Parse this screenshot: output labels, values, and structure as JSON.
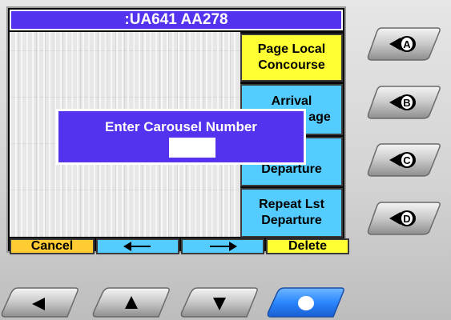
{
  "screen": {
    "title": ":UA641  AA278",
    "softkeys": [
      {
        "line1": "Page Local",
        "line2": "Concourse"
      },
      {
        "line1": "Arrival",
        "line2": "age"
      },
      {
        "line1": "t",
        "line2": "Departure"
      },
      {
        "line1": "Repeat Lst",
        "line2": "Departure"
      }
    ],
    "bottom_keys": {
      "cancel": "Cancel",
      "left_arrow": "left-arrow-icon",
      "right_arrow": "right-arrow-icon",
      "delete": "Delete"
    }
  },
  "dialog": {
    "title": "Enter Carousel Number",
    "input_value": ""
  },
  "side_buttons": [
    {
      "letter": "A"
    },
    {
      "letter": "B"
    },
    {
      "letter": "C"
    },
    {
      "letter": "D"
    }
  ],
  "nav_buttons": [
    "left-triangle-icon",
    "up-triangle-icon",
    "down-triangle-icon",
    "circle-icon"
  ],
  "colors": {
    "title_bg": "#5533ee",
    "softkey_yellow": "#ffff33",
    "softkey_blue": "#55ccff",
    "cancel_orange": "#ffcc33",
    "nav_select_blue": "#2288ff"
  }
}
